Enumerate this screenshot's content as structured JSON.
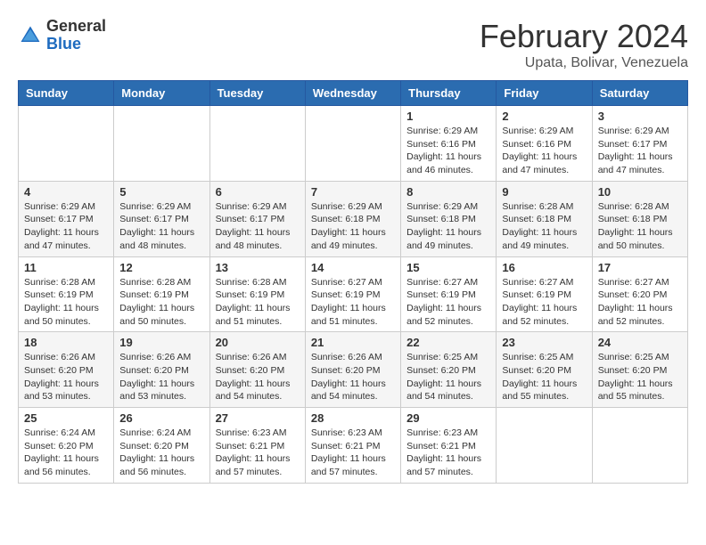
{
  "logo": {
    "general": "General",
    "blue": "Blue"
  },
  "title": "February 2024",
  "subtitle": "Upata, Bolivar, Venezuela",
  "headers": [
    "Sunday",
    "Monday",
    "Tuesday",
    "Wednesday",
    "Thursday",
    "Friday",
    "Saturday"
  ],
  "weeks": [
    [
      {
        "day": "",
        "info": ""
      },
      {
        "day": "",
        "info": ""
      },
      {
        "day": "",
        "info": ""
      },
      {
        "day": "",
        "info": ""
      },
      {
        "day": "1",
        "info": "Sunrise: 6:29 AM\nSunset: 6:16 PM\nDaylight: 11 hours\nand 46 minutes."
      },
      {
        "day": "2",
        "info": "Sunrise: 6:29 AM\nSunset: 6:16 PM\nDaylight: 11 hours\nand 47 minutes."
      },
      {
        "day": "3",
        "info": "Sunrise: 6:29 AM\nSunset: 6:17 PM\nDaylight: 11 hours\nand 47 minutes."
      }
    ],
    [
      {
        "day": "4",
        "info": "Sunrise: 6:29 AM\nSunset: 6:17 PM\nDaylight: 11 hours\nand 47 minutes."
      },
      {
        "day": "5",
        "info": "Sunrise: 6:29 AM\nSunset: 6:17 PM\nDaylight: 11 hours\nand 48 minutes."
      },
      {
        "day": "6",
        "info": "Sunrise: 6:29 AM\nSunset: 6:17 PM\nDaylight: 11 hours\nand 48 minutes."
      },
      {
        "day": "7",
        "info": "Sunrise: 6:29 AM\nSunset: 6:18 PM\nDaylight: 11 hours\nand 49 minutes."
      },
      {
        "day": "8",
        "info": "Sunrise: 6:29 AM\nSunset: 6:18 PM\nDaylight: 11 hours\nand 49 minutes."
      },
      {
        "day": "9",
        "info": "Sunrise: 6:28 AM\nSunset: 6:18 PM\nDaylight: 11 hours\nand 49 minutes."
      },
      {
        "day": "10",
        "info": "Sunrise: 6:28 AM\nSunset: 6:18 PM\nDaylight: 11 hours\nand 50 minutes."
      }
    ],
    [
      {
        "day": "11",
        "info": "Sunrise: 6:28 AM\nSunset: 6:19 PM\nDaylight: 11 hours\nand 50 minutes."
      },
      {
        "day": "12",
        "info": "Sunrise: 6:28 AM\nSunset: 6:19 PM\nDaylight: 11 hours\nand 50 minutes."
      },
      {
        "day": "13",
        "info": "Sunrise: 6:28 AM\nSunset: 6:19 PM\nDaylight: 11 hours\nand 51 minutes."
      },
      {
        "day": "14",
        "info": "Sunrise: 6:27 AM\nSunset: 6:19 PM\nDaylight: 11 hours\nand 51 minutes."
      },
      {
        "day": "15",
        "info": "Sunrise: 6:27 AM\nSunset: 6:19 PM\nDaylight: 11 hours\nand 52 minutes."
      },
      {
        "day": "16",
        "info": "Sunrise: 6:27 AM\nSunset: 6:19 PM\nDaylight: 11 hours\nand 52 minutes."
      },
      {
        "day": "17",
        "info": "Sunrise: 6:27 AM\nSunset: 6:20 PM\nDaylight: 11 hours\nand 52 minutes."
      }
    ],
    [
      {
        "day": "18",
        "info": "Sunrise: 6:26 AM\nSunset: 6:20 PM\nDaylight: 11 hours\nand 53 minutes."
      },
      {
        "day": "19",
        "info": "Sunrise: 6:26 AM\nSunset: 6:20 PM\nDaylight: 11 hours\nand 53 minutes."
      },
      {
        "day": "20",
        "info": "Sunrise: 6:26 AM\nSunset: 6:20 PM\nDaylight: 11 hours\nand 54 minutes."
      },
      {
        "day": "21",
        "info": "Sunrise: 6:26 AM\nSunset: 6:20 PM\nDaylight: 11 hours\nand 54 minutes."
      },
      {
        "day": "22",
        "info": "Sunrise: 6:25 AM\nSunset: 6:20 PM\nDaylight: 11 hours\nand 54 minutes."
      },
      {
        "day": "23",
        "info": "Sunrise: 6:25 AM\nSunset: 6:20 PM\nDaylight: 11 hours\nand 55 minutes."
      },
      {
        "day": "24",
        "info": "Sunrise: 6:25 AM\nSunset: 6:20 PM\nDaylight: 11 hours\nand 55 minutes."
      }
    ],
    [
      {
        "day": "25",
        "info": "Sunrise: 6:24 AM\nSunset: 6:20 PM\nDaylight: 11 hours\nand 56 minutes."
      },
      {
        "day": "26",
        "info": "Sunrise: 6:24 AM\nSunset: 6:20 PM\nDaylight: 11 hours\nand 56 minutes."
      },
      {
        "day": "27",
        "info": "Sunrise: 6:23 AM\nSunset: 6:21 PM\nDaylight: 11 hours\nand 57 minutes."
      },
      {
        "day": "28",
        "info": "Sunrise: 6:23 AM\nSunset: 6:21 PM\nDaylight: 11 hours\nand 57 minutes."
      },
      {
        "day": "29",
        "info": "Sunrise: 6:23 AM\nSunset: 6:21 PM\nDaylight: 11 hours\nand 57 minutes."
      },
      {
        "day": "",
        "info": ""
      },
      {
        "day": "",
        "info": ""
      }
    ]
  ]
}
